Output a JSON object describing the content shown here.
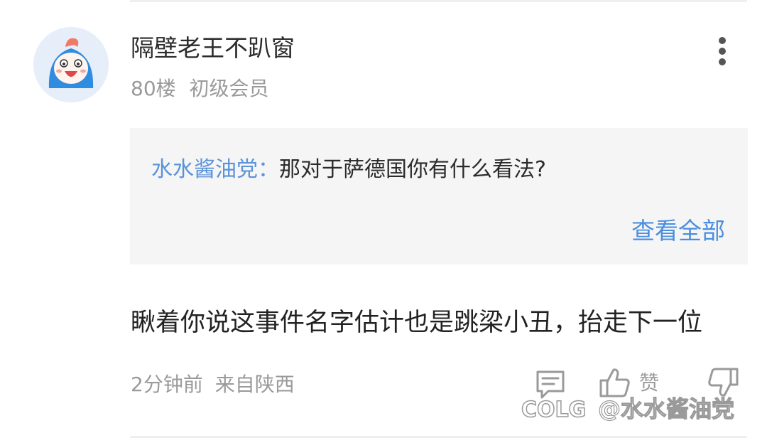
{
  "post": {
    "username": "隔壁老王不趴窗",
    "floor": "80楼",
    "rank": "初级会员",
    "quote": {
      "author": "水水酱油党：",
      "text": "那对于萨德国你有什么看法?",
      "view_all_label": "查看全部"
    },
    "comment_text": "瞅着你说这事件名字估计也是跳梁小丑，抬走下一位",
    "time": "2分钟前",
    "location": "来自陕西",
    "actions": {
      "reply_icon": "comment-icon",
      "like_icon": "thumbs-up-icon",
      "like_label": "赞",
      "dislike_icon": "thumbs-down-icon",
      "more_icon": "more-vertical-icon"
    }
  },
  "watermark": {
    "logo": "COLG",
    "text": "@水水酱油党"
  },
  "colors": {
    "accent_blue": "#4a8ee0",
    "author_blue": "#5b93d9",
    "quote_bg": "#f5f5f5",
    "text_primary": "#222222",
    "text_secondary": "#9a9a9a"
  }
}
